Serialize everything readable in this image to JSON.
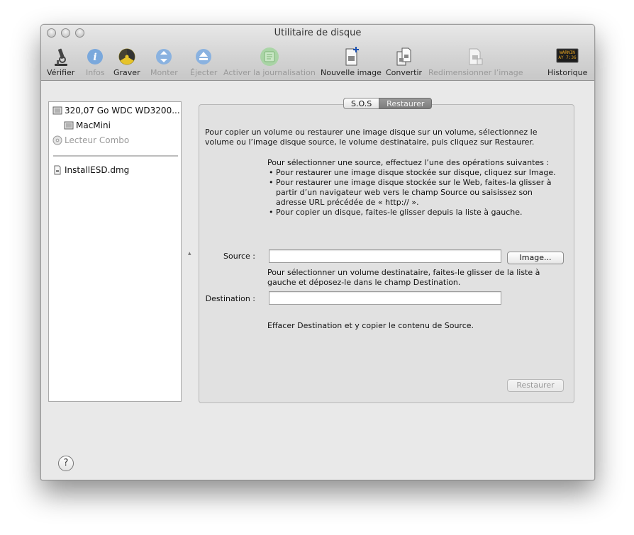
{
  "window": {
    "title": "Utilitaire de disque"
  },
  "toolbar": {
    "items": [
      {
        "label": "Vérifier",
        "icon": "microscope-icon",
        "enabled": true
      },
      {
        "label": "Infos",
        "icon": "info-icon",
        "enabled": false
      },
      {
        "label": "Graver",
        "icon": "burn-icon",
        "enabled": true
      },
      {
        "label": "Monter",
        "icon": "mount-icon",
        "enabled": false
      },
      {
        "label": "Éjecter",
        "icon": "eject-icon",
        "enabled": false
      },
      {
        "label": "Activer la journalisation",
        "icon": "journal-icon",
        "enabled": false
      },
      {
        "label": "Nouvelle image",
        "icon": "new-image-icon",
        "enabled": true
      },
      {
        "label": "Convertir",
        "icon": "convert-icon",
        "enabled": true
      },
      {
        "label": "Redimensionner l’image",
        "icon": "resize-image-icon",
        "enabled": false
      },
      {
        "label": "Historique",
        "icon": "log-icon",
        "enabled": true
      }
    ],
    "log_icon_text": [
      "WARNIN",
      "AY 7:36"
    ]
  },
  "sidebar": {
    "items": [
      {
        "label": "320,07 Go WDC WD3200...",
        "icon": "hard-disk-icon"
      },
      {
        "label": "MacMini",
        "icon": "volume-icon"
      },
      {
        "label": "Lecteur Combo",
        "icon": "optical-drive-icon",
        "dim": true
      },
      {
        "label": "InstallESD.dmg",
        "icon": "disk-image-icon"
      }
    ]
  },
  "tabs": {
    "sos": "S.O.S",
    "restore": "Restaurer"
  },
  "restore": {
    "intro": "Pour copier un volume ou restaurer une image disque sur un volume, sélectionnez le volume ou l’image disque source, le volume destinataire, puis cliquez sur Restaurer.",
    "source_help_title": "Pour sélectionner une source, effectuez l’une des opérations suivantes :",
    "source_help_bullets": [
      "Pour restaurer une image disque stockée sur disque, cliquez sur Image.",
      "Pour restaurer une image disque stockée sur le Web, faites-la glisser à partir d’un navigateur web vers le champ Source ou saisissez son adresse URL précédée de « http:// ».",
      "Pour copier un disque, faites-le glisser depuis la liste à gauche."
    ],
    "source_label": "Source :",
    "source_value": "",
    "image_button": "Image...",
    "dest_help": "Pour sélectionner un volume destinataire, faites-le glisser de la liste à gauche et déposez-le dans le champ Destination.",
    "dest_label": "Destination :",
    "dest_value": "",
    "erase_text": "Effacer Destination et y copier le contenu de Source.",
    "restore_button": "Restaurer"
  },
  "help_button": "?"
}
